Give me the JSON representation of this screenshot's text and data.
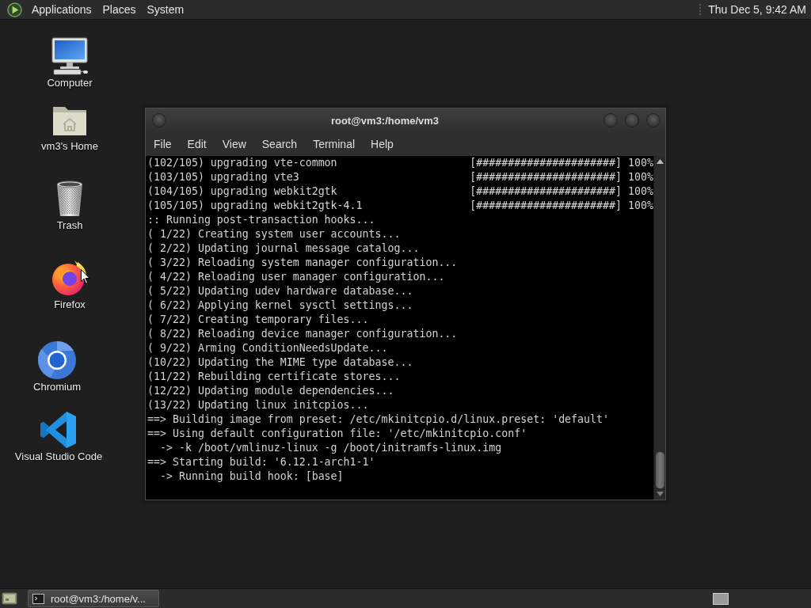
{
  "top_panel": {
    "menus": [
      "Applications",
      "Places",
      "System"
    ],
    "clock": "Thu Dec 5, 9:42 AM"
  },
  "desktop_icons": [
    {
      "kind": "computer",
      "label": "Computer"
    },
    {
      "kind": "home",
      "label": "vm3's Home"
    },
    {
      "kind": "trash",
      "label": "Trash"
    },
    {
      "kind": "firefox",
      "label": "Firefox"
    },
    {
      "kind": "chromium",
      "label": "Chromium"
    },
    {
      "kind": "vscode",
      "label": "Visual Studio Code"
    }
  ],
  "terminal_window": {
    "title": "root@vm3:/home/vm3",
    "menu": [
      "File",
      "Edit",
      "View",
      "Search",
      "Terminal",
      "Help"
    ],
    "lines": [
      {
        "kind": "progress",
        "text": "(102/105) upgrading vte-common",
        "bar": "[######################]",
        "percent": "100%"
      },
      {
        "kind": "progress",
        "text": "(103/105) upgrading vte3",
        "bar": "[######################]",
        "percent": "100%"
      },
      {
        "kind": "progress",
        "text": "(104/105) upgrading webkit2gtk",
        "bar": "[######################]",
        "percent": "100%"
      },
      {
        "kind": "progress",
        "text": "(105/105) upgrading webkit2gtk-4.1",
        "bar": "[######################]",
        "percent": "100%"
      },
      {
        "kind": "text",
        "text": ":: Running post-transaction hooks..."
      },
      {
        "kind": "text",
        "text": "( 1/22) Creating system user accounts..."
      },
      {
        "kind": "text",
        "text": "( 2/22) Updating journal message catalog..."
      },
      {
        "kind": "text",
        "text": "( 3/22) Reloading system manager configuration..."
      },
      {
        "kind": "text",
        "text": "( 4/22) Reloading user manager configuration..."
      },
      {
        "kind": "text",
        "text": "( 5/22) Updating udev hardware database..."
      },
      {
        "kind": "text",
        "text": "( 6/22) Applying kernel sysctl settings..."
      },
      {
        "kind": "text",
        "text": "( 7/22) Creating temporary files..."
      },
      {
        "kind": "text",
        "text": "( 8/22) Reloading device manager configuration..."
      },
      {
        "kind": "text",
        "text": "( 9/22) Arming ConditionNeedsUpdate..."
      },
      {
        "kind": "text",
        "text": "(10/22) Updating the MIME type database..."
      },
      {
        "kind": "text",
        "text": "(11/22) Rebuilding certificate stores..."
      },
      {
        "kind": "text",
        "text": "(12/22) Updating module dependencies..."
      },
      {
        "kind": "text",
        "text": "(13/22) Updating linux initcpios..."
      },
      {
        "kind": "text",
        "text": "==> Building image from preset: /etc/mkinitcpio.d/linux.preset: 'default'"
      },
      {
        "kind": "text",
        "text": "==> Using default configuration file: '/etc/mkinitcpio.conf'"
      },
      {
        "kind": "text",
        "text": "  -> -k /boot/vmlinuz-linux -g /boot/initramfs-linux.img"
      },
      {
        "kind": "text",
        "text": "==> Starting build: '6.12.1-arch1-1'"
      },
      {
        "kind": "text",
        "text": "  -> Running build hook: [base]"
      }
    ]
  },
  "taskbar": {
    "tasks": [
      {
        "label": "root@vm3:/home/v...",
        "selected": true
      }
    ]
  }
}
